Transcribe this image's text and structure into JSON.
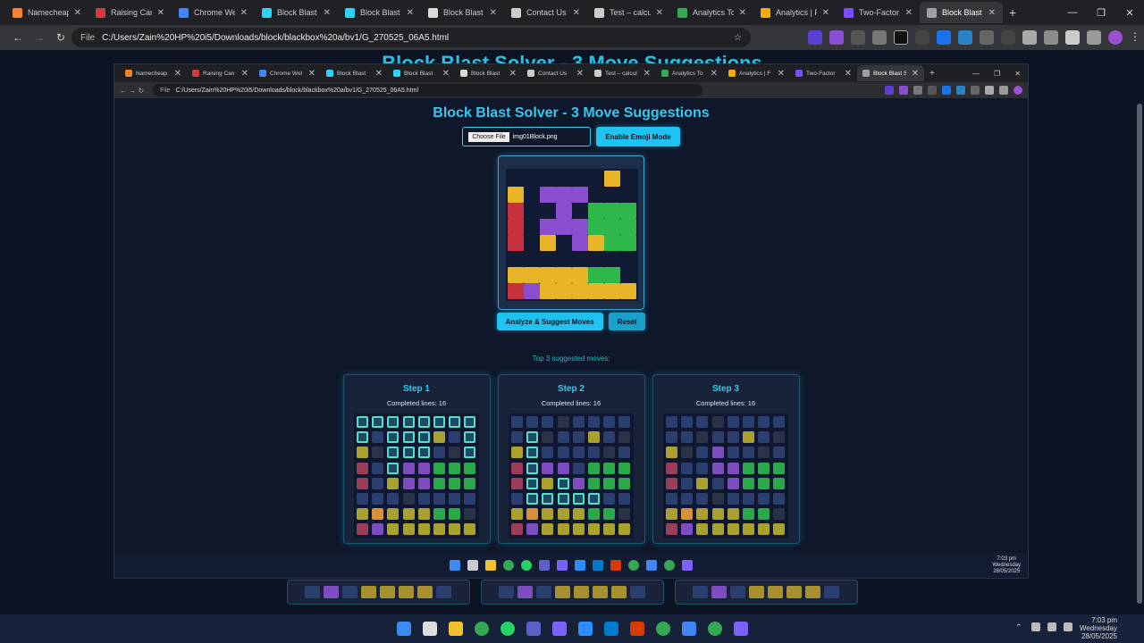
{
  "outer": {
    "tabs": [
      {
        "label": "Namecheap",
        "color": "#f6822b"
      },
      {
        "label": "Raising Cane",
        "color": "#d33c3c"
      },
      {
        "label": "Chrome Wel",
        "color": "#4285f4"
      },
      {
        "label": "Block Blast S",
        "color": "#2bd3f6"
      },
      {
        "label": "Block Blast S",
        "color": "#2bd3f6"
      },
      {
        "label": "Block Blast S",
        "color": "#d9d9d9"
      },
      {
        "label": "Contact Us",
        "color": "#cccccc"
      },
      {
        "label": "Test – calcul",
        "color": "#cccccc"
      },
      {
        "label": "Analytics To",
        "color": "#34a853"
      },
      {
        "label": "Analytics | F",
        "color": "#f9ab00"
      },
      {
        "label": "Two-Factor",
        "color": "#7c4dff"
      },
      {
        "label": "Block Blast S",
        "color": "#9aa0a6",
        "active": true
      }
    ],
    "url_prefix": "File",
    "url": "C:/Users/Zain%20HP%20i5/Downloads/block/blackbox%20a/bv1/G_270525_06A5.html"
  },
  "inner": {
    "tabs": [
      {
        "label": "Namecheap",
        "color": "#f6822b"
      },
      {
        "label": "Raising Can",
        "color": "#d33c3c"
      },
      {
        "label": "Chrome Wel",
        "color": "#4285f4"
      },
      {
        "label": "Block Blast",
        "color": "#2bd3f6"
      },
      {
        "label": "Block Blast",
        "color": "#2bd3f6"
      },
      {
        "label": "Block Blast",
        "color": "#d9d9d9"
      },
      {
        "label": "Contact Us",
        "color": "#cccccc"
      },
      {
        "label": "Test – calcul",
        "color": "#cccccc"
      },
      {
        "label": "Analytics To",
        "color": "#34a853"
      },
      {
        "label": "Analytics | F",
        "color": "#f9ab00"
      },
      {
        "label": "Two-Factor",
        "color": "#7c4dff"
      },
      {
        "label": "Block Blast S",
        "color": "#9aa0a6",
        "active": true
      }
    ],
    "url_prefix": "File",
    "url": "C:/Users/Zain%20HP%20i5/Downloads/block/blackbox%20a/bv1/G_270525_06A5.html"
  },
  "page": {
    "bg_title": "Block Blast Solver - 3 Move Suggestions",
    "title": "Block Blast Solver - 3 Move Suggestions",
    "choose_file": "Choose File",
    "file_name": "img01Block.png",
    "emoji_button": "Enable Emoji Mode",
    "analyze_button": "Analyze & Suggest Moves",
    "reset_button": "Reset",
    "suggested_label": "Top 3 suggested moves:"
  },
  "board_grid": [
    "........",
    "......Y.",
    "Y.PPP...",
    "R..P.GGG",
    "R.PPPGGG",
    "R.Y.PYGG",
    "........",
    "YYYYYGG.",
    "RPYYYYYY"
  ],
  "colors": {
    "Y": "#e8b428",
    "R": "#c8323c",
    "P": "#8a4dcf",
    "G": "#2fb84a",
    "empty": "#2b4378",
    "accent": "#1fc2f0"
  },
  "steps": [
    {
      "title": "Step 1",
      "completed": "Completed lines: 16",
      "grid": [
        "HHHHHHHH",
        "H.HHHY.H",
        "Y.HHH..H",
        "R.HPPGGG",
        "R.YPPGGG",
        "........",
        "YOYYYGG.",
        "RPYYYYYY"
      ]
    },
    {
      "title": "Step 2",
      "completed": "Completed lines: 16",
      "grid": [
        "........",
        ".H...Y..",
        "YH......",
        "RHPP.GGG",
        "RHYHPGGG",
        ".HHHHH..",
        "YOYYYGG.",
        "RPYYYYYY"
      ]
    },
    {
      "title": "Step 3",
      "completed": "Completed lines: 16",
      "grid": [
        "........",
        ".....Y..",
        "Y..P....",
        "R..PPGGG",
        "R.Y.PGGG",
        "........",
        "YOYYYGG.",
        "RPYYYYYY"
      ]
    }
  ],
  "mini_colors": {
    "Y": "#a9a02e",
    "R": "#9a3e5a",
    "P": "#7d4dbf",
    "G": "#2aa84a",
    "O": "#d9903a",
    "H": "#1e4a66",
    "empty": "#2a3f6e",
    "dark": "#2a3346"
  },
  "bottom_rows": [
    [
      "#2a3f6e",
      "#7d4dbf",
      "#2a3f6e",
      "#a9902e",
      "#a9902e",
      "#a9902e",
      "#a9902e",
      "#2a3f6e"
    ],
    [
      "#2a3f6e",
      "#7d4dbf",
      "#2a3f6e",
      "#a9902e",
      "#a9902e",
      "#a9902e",
      "#a9902e",
      "#2a3f6e"
    ],
    [
      "#2a3f6e",
      "#7d4dbf",
      "#2a3f6e",
      "#a9902e",
      "#a9902e",
      "#a9902e",
      "#a9902e",
      "#2a3f6e"
    ]
  ],
  "taskbar": {
    "icons": [
      "windows-icon",
      "search-icon",
      "folder-icon",
      "chrome-icon",
      "whatsapp-icon",
      "teams-icon",
      "app-icon",
      "zoom-icon",
      "vscode-icon",
      "tool-icon",
      "chrome-icon",
      "notes-icon",
      "chrome-icon",
      "camera-icon"
    ],
    "time": "7:03 pm",
    "day": "Wednesday",
    "date": "28/05/2025"
  }
}
